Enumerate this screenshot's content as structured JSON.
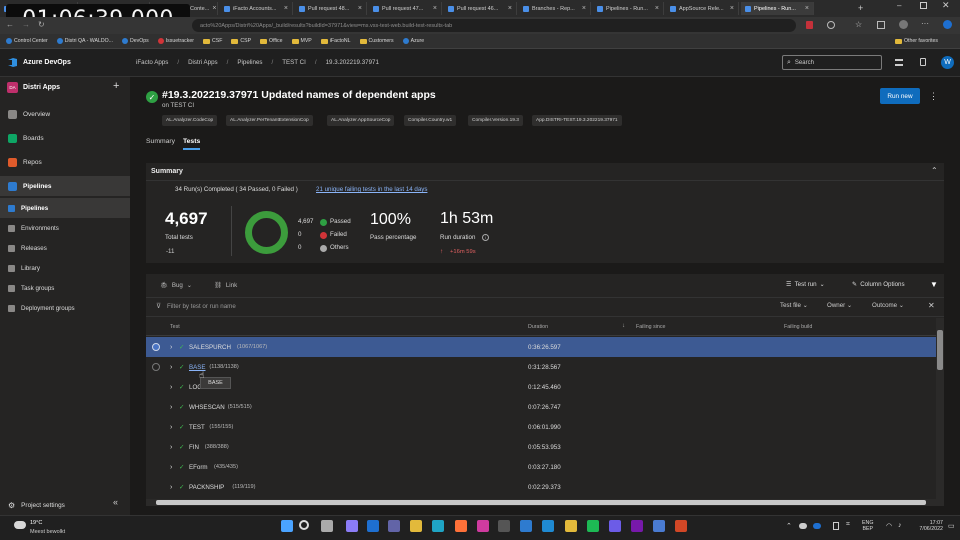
{
  "recording_timer": "01:06:39.000",
  "browser": {
    "tabs": [
      {
        "title": "Requests · Dev..."
      },
      {
        "title": "ERP Eyes Lun..."
      },
      {
        "title": "HADOCK Conte..."
      },
      {
        "title": "iFacto Accounts..."
      },
      {
        "title": "Pull request 48..."
      },
      {
        "title": "Pull request 47..."
      },
      {
        "title": "Pull request 46..."
      },
      {
        "title": "Branches - Rep..."
      },
      {
        "title": "Pipelines - Run..."
      },
      {
        "title": "AppSource Rele..."
      },
      {
        "title": "Pipelines - Run..."
      }
    ],
    "url": "acto%20Apps/Distri%20Apps/_build/results?buildId=37971&view=ms.vss-test-web.build-test-results-tab",
    "bookmarks": [
      "Control Center",
      "Distri QA - WALDO...",
      "DevOps",
      "Issuetracker",
      "CSF",
      "CSP",
      "Office",
      "MVP",
      "iFactoNL",
      "Customers",
      "Azure"
    ],
    "other_favorites": "Other favorites"
  },
  "ado": {
    "brand": "Azure DevOps",
    "breadcrumbs": [
      "iFacto Apps",
      "Distri Apps",
      "Pipelines",
      "TEST CI",
      "19.3.202219.37971"
    ],
    "search_placeholder": "Search",
    "avatar_initial": "W"
  },
  "sidebar": {
    "project_badge": "DA",
    "project_name": "Distri Apps",
    "items": [
      {
        "label": "Overview",
        "color": "#8a8886"
      },
      {
        "label": "Boards",
        "color": "#0ea665"
      },
      {
        "label": "Repos",
        "color": "#e05b2b"
      },
      {
        "label": "Pipelines",
        "color": "#2e7bcf"
      },
      {
        "label": "Pipelines",
        "color": "#2e7bcf"
      },
      {
        "label": "Environments",
        "color": "#8a8886"
      },
      {
        "label": "Releases",
        "color": "#8a8886"
      },
      {
        "label": "Library",
        "color": "#8a8886"
      },
      {
        "label": "Task groups",
        "color": "#8a8886"
      },
      {
        "label": "Deployment groups",
        "color": "#8a8886"
      }
    ],
    "project_settings": "Project settings"
  },
  "run": {
    "title": "#19.3.202219.37971 Updated names of dependent apps",
    "subtitle": "on TEST CI",
    "run_new": "Run new",
    "chips": [
      "AL.Analyzer.CodeCop",
      "AL.Analyzer.PerTenantExtensionCop",
      "AL.Analyzer.AppSourceCop",
      "Compiler.Country.w1",
      "Compiler.Version.19.3",
      "App.DISTRI-TEST.19.3.202219.37971"
    ],
    "tabs": [
      "Summary",
      "Tests"
    ]
  },
  "summary": {
    "header": "Summary",
    "runs_text": "34 Run(s) Completed ( 34 Passed, 0 Failed )",
    "failing_link": "21 unique failing tests in the last 14 days",
    "total_tests": "4,697",
    "total_label": "Total tests",
    "total_delta": "-11",
    "legend": [
      {
        "count": "4,697",
        "label": "Passed",
        "color": "#2ea043"
      },
      {
        "count": "0",
        "label": "Failed",
        "color": "#d13438"
      },
      {
        "count": "0",
        "label": "Others",
        "color": "#aaaaaa"
      }
    ],
    "pass_pct": "100%",
    "pass_label": "Pass percentage",
    "duration": "1h 53m",
    "duration_label": "Run duration",
    "duration_delta": "+16m 59s"
  },
  "toolbar": {
    "bug": "Bug",
    "link": "Link",
    "test_run": "Test run",
    "column_options": "Column Options",
    "filter_placeholder": "Filter by test or run name",
    "test_file": "Test file",
    "owner": "Owner",
    "outcome": "Outcome"
  },
  "table": {
    "columns": [
      "Test",
      "Duration",
      "Failing since",
      "Failing build"
    ],
    "rows": [
      {
        "name": "SALESPURCH",
        "count": "(1067/1067)",
        "duration": "0:36:26.597"
      },
      {
        "name": "BASE",
        "count": "(1138/1138)",
        "duration": "0:31:28.567"
      },
      {
        "name": "LOGI",
        "count": "7/377)",
        "duration": "0:12:45.460"
      },
      {
        "name": "WHSESCAN",
        "count": "(515/515)",
        "duration": "0:07:26.747"
      },
      {
        "name": "TEST",
        "count": "(155/155)",
        "duration": "0:06:01.990"
      },
      {
        "name": "FIN",
        "count": "(388/388)",
        "duration": "0:05:53.953"
      },
      {
        "name": "EForm",
        "count": "(435/435)",
        "duration": "0:03:27.180"
      },
      {
        "name": "PACKNSHIP",
        "count": "(119/119)",
        "duration": "0:02:29.373"
      }
    ],
    "tooltip": "BASE"
  },
  "taskbar": {
    "weather_temp": "19°C",
    "weather_text": "Meest bewolkt",
    "lang_top": "ENG",
    "lang_bottom": "BEP",
    "time": "17:07",
    "date": "7/06/2022"
  }
}
